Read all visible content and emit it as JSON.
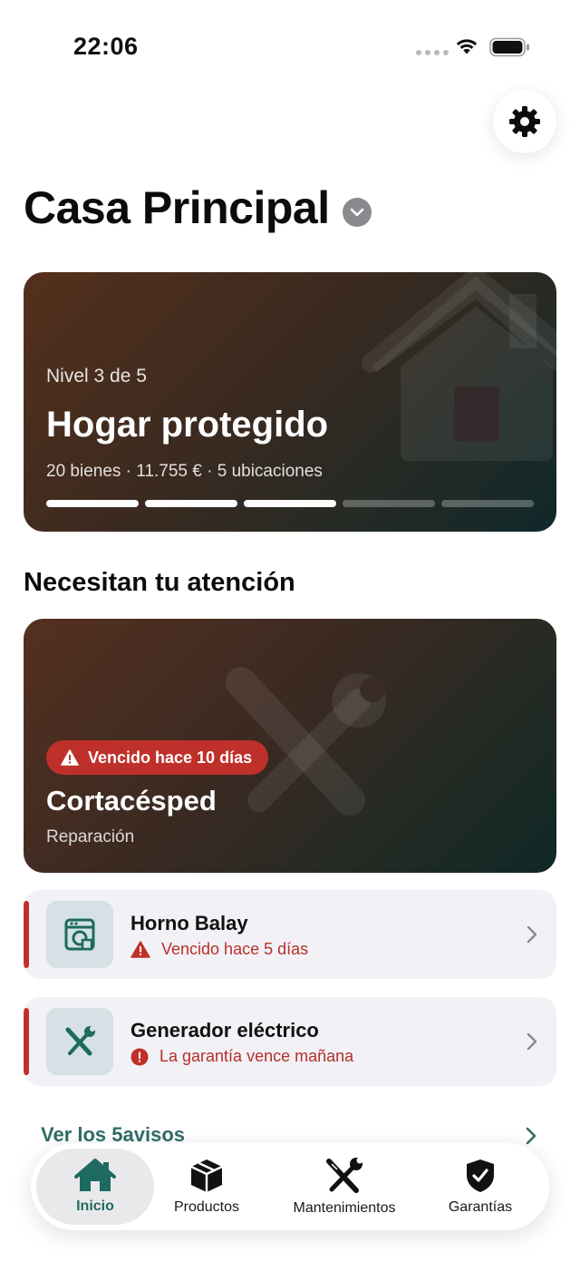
{
  "status_bar": {
    "time": "22:06"
  },
  "header": {
    "title": "Casa Principal"
  },
  "level_card": {
    "caption": "Nivel 3 de 5",
    "title": "Hogar protegido",
    "stats": "20 bienes · 11.755 € · 5 ubicaciones",
    "level": 3,
    "levels_total": 5
  },
  "attention": {
    "section_title": "Necesitan tu atención",
    "featured": {
      "badge": "Vencido hace 10 días",
      "name": "Cortacésped",
      "subtitle": "Reparación"
    },
    "items": [
      {
        "name": "Horno Balay",
        "status": "Vencido hace 5 días",
        "icon": "oven-icon",
        "status_icon": "warning-triangle-icon"
      },
      {
        "name": "Generador eléctrico",
        "status": "La garantía vence mañana",
        "icon": "tools-icon",
        "status_icon": "exclamation-circle-icon"
      }
    ],
    "more_link": "Ver los 5avisos"
  },
  "tabs": [
    {
      "label": "Inicio",
      "icon": "home-icon",
      "active": true
    },
    {
      "label": "Productos",
      "icon": "box-icon",
      "active": false
    },
    {
      "label": "Mantenimientos",
      "icon": "tools-icon",
      "active": false
    },
    {
      "label": "Garantías",
      "icon": "shield-check-icon",
      "active": false
    }
  ],
  "colors": {
    "accent": "#1e6a60",
    "alert_red": "#c0302a",
    "card_gradient_start": "#55301c",
    "card_gradient_end": "#10292a"
  }
}
